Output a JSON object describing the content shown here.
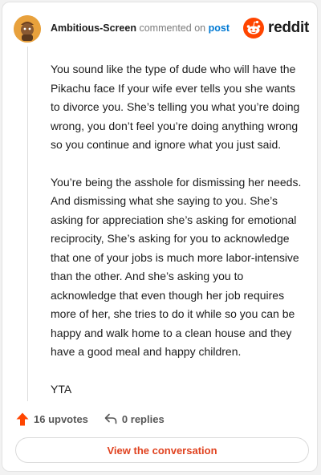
{
  "header": {
    "username": "Ambitious-Screen",
    "commented_on": "commented on",
    "post_link": "post",
    "brand": "reddit",
    "avatar_icon": "snoo-avatar-icon",
    "brand_icon": "reddit-logo-icon"
  },
  "comment": {
    "paragraphs": [
      "You sound like the type of dude who will have the Pikachu face If your wife ever tells you she wants to divorce you. She’s telling you what you’re doing wrong, you don’t feel you’re doing anything wrong so you continue and ignore what you just said.",
      "You’re being the asshole for dismissing her needs. And dismissing what she saying to you. She’s asking for appreciation she’s asking for emotional reciprocity, She’s asking for you to acknowledge that one of your jobs is much more labor-intensive than the other. And she’s asking you to acknowledge that even though her job requires more of her, she tries to do it while so you can be happy and walk home to a clean house and they have a good meal and happy children.",
      "YTA"
    ]
  },
  "actions": {
    "upvotes": "16 upvotes",
    "replies": "0 replies",
    "upvote_icon": "upvote-arrow-icon",
    "reply_icon": "reply-arrow-icon"
  },
  "cta": {
    "label": "View the conversation"
  },
  "colors": {
    "accent": "#ff4500",
    "link": "#0079d3",
    "cta_text": "#e0421f",
    "text": "#1c1c1c"
  }
}
